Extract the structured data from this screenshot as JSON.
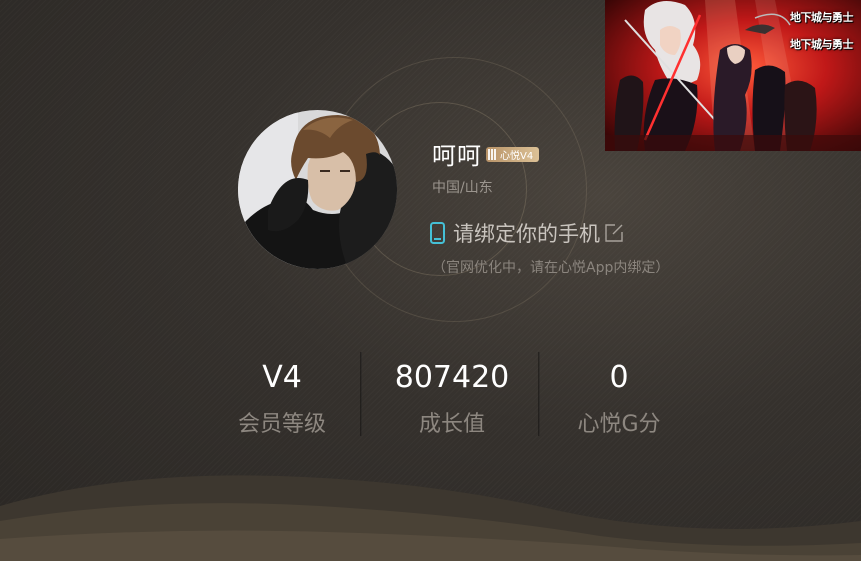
{
  "user": {
    "name": "呵呵",
    "vip_badge": "心悦V4",
    "location": "中国/山东",
    "bind_phone_text": "请绑定你的手机",
    "bind_note": "（官网优化中，请在心悦App内绑定）"
  },
  "stats": [
    {
      "value": "V4",
      "label": "会员等级"
    },
    {
      "value": "807420",
      "label": "成长值"
    },
    {
      "value": "0",
      "label": "心悦G分"
    }
  ],
  "banner": {
    "logo_text": "地下城与勇士"
  },
  "colors": {
    "accent_cyan": "#45c0d6",
    "vip_gold": "#c9a67a",
    "background_dark": "#2e2a27"
  },
  "icons": {
    "phone": "phone-icon",
    "edit": "edit-icon",
    "vip": "vip-badge-icon"
  }
}
